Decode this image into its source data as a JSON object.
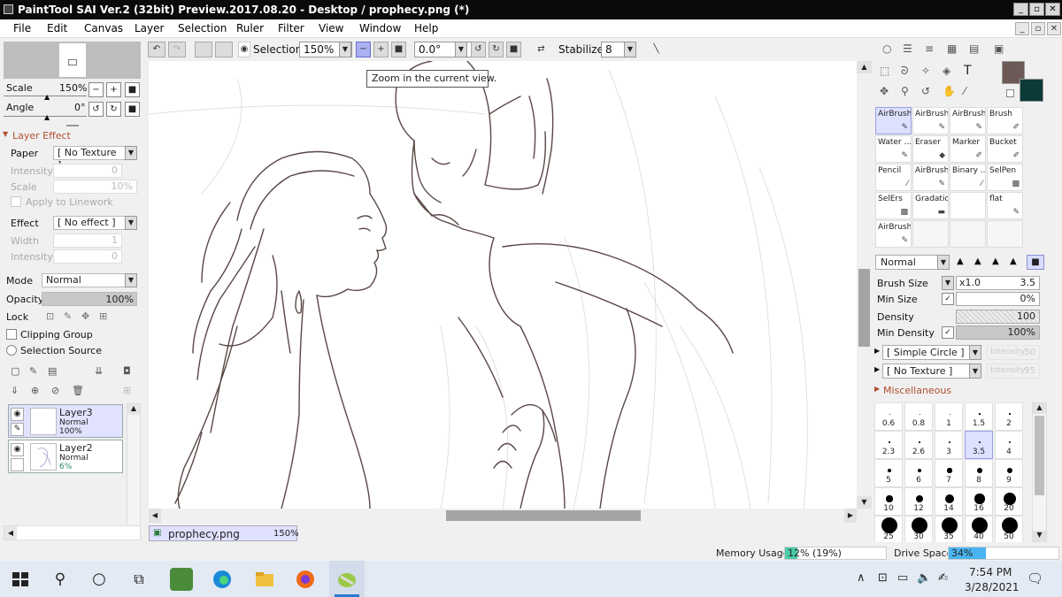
{
  "window": {
    "title": "PaintTool SAI Ver.2 (32bit) Preview.2017.08.20 - Desktop / prophecy.png (*)"
  },
  "menu": [
    "File",
    "Edit",
    "Canvas",
    "Layer",
    "Selection",
    "Ruler",
    "Filter",
    "View",
    "Window",
    "Help"
  ],
  "toolbar": {
    "selection_label": "Selection",
    "zoom_value": "150%",
    "rotation_value": "0.0°",
    "stabilizer_label": "Stabilizer",
    "stabilizer_value": "8"
  },
  "tooltip": "Zoom in the current view.",
  "navigator": {
    "scale_label": "Scale",
    "scale_value": "150%",
    "angle_label": "Angle",
    "angle_value": "0°"
  },
  "layer_effect": {
    "header": "Layer Effect",
    "paper_label": "Paper",
    "paper_value": "[ No Texture ]",
    "intensity_label": "Intensity",
    "intensity_value": "0",
    "scale_label": "Scale",
    "scale_value": "10%",
    "apply_linework": "Apply to Linework",
    "effect_label": "Effect",
    "effect_value": "[ No effect ]",
    "width_label": "Width",
    "width_value": "1",
    "intensity2_label": "Intensity",
    "intensity2_value": "0"
  },
  "layer_props": {
    "mode_label": "Mode",
    "mode_value": "Normal",
    "opacity_label": "Opacity",
    "opacity_value": "100%",
    "opacity_fraction": 1.0,
    "lock_label": "Lock",
    "clipping_group": "Clipping Group",
    "selection_source": "Selection Source"
  },
  "layers": [
    {
      "name": "Layer3",
      "mode": "Normal",
      "opacity": "100%"
    },
    {
      "name": "Layer2",
      "mode": "Normal",
      "opacity": "6%"
    }
  ],
  "document_tab": {
    "name": "prophecy.png",
    "zoom": "150%"
  },
  "brushes": [
    {
      "name": "AirBrush"
    },
    {
      "name": "AirBrush"
    },
    {
      "name": "AirBrush"
    },
    {
      "name": "Brush"
    },
    {
      "name": "Water ..."
    },
    {
      "name": "Eraser"
    },
    {
      "name": "Marker"
    },
    {
      "name": "Bucket"
    },
    {
      "name": "Pencil"
    },
    {
      "name": "AirBrush"
    },
    {
      "name": "Binary ..."
    },
    {
      "name": "SelPen"
    },
    {
      "name": "SelErs"
    },
    {
      "name": "Gradation"
    },
    {
      "name": ""
    },
    {
      "name": "flat"
    },
    {
      "name": "AirBrush"
    }
  ],
  "brush_props": {
    "blend_mode": "Normal",
    "size_label": "Brush Size",
    "size_multiplier": "x1.0",
    "size_value": "3.5",
    "min_size_label": "Min Size",
    "min_size_value": "0%",
    "density_label": "Density",
    "density_value": "100",
    "min_density_label": "Min Density",
    "min_density_value": "100%",
    "shape_value": "[ Simple Circle ]",
    "shape_intensity_label": "Intensity",
    "shape_intensity_value": "50",
    "texture_value": "[ No Texture ]",
    "texture_intensity_label": "Intensity",
    "texture_intensity_value": "95",
    "misc_label": "Miscellaneous"
  },
  "brush_sizes": [
    "0.6",
    "0.8",
    "1",
    "1.5",
    "2",
    "2.3",
    "2.6",
    "3",
    "3.5",
    "4",
    "5",
    "6",
    "7",
    "8",
    "9",
    "10",
    "12",
    "14",
    "16",
    "20",
    "25",
    "30",
    "35",
    "40",
    "50"
  ],
  "selected_brush_size": "3.5",
  "colors": {
    "primary": "#6b5a55",
    "secondary": "#0b3a38",
    "accent": "#9aa0e0"
  },
  "status": {
    "memory_label": "Memory Usage",
    "memory_value": "12% (19%)",
    "memory_fraction": 0.12,
    "drive_label": "Drive Space",
    "drive_value": "34%",
    "drive_fraction": 0.34
  },
  "taskbar": {
    "time": "7:54 PM",
    "date": "3/28/2021"
  }
}
